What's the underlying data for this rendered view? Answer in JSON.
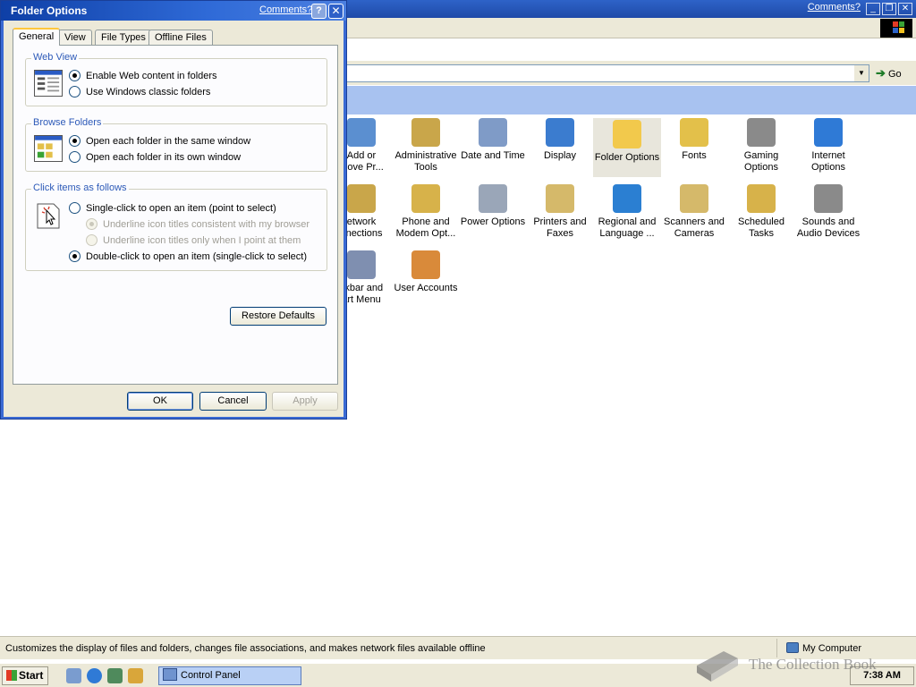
{
  "control_panel": {
    "comments_link": "Comments?",
    "window_buttons": {
      "minimize": "_",
      "maximize": "❐",
      "close": "✕"
    },
    "go_button": "Go",
    "icons": [
      {
        "id": "add-remove-programs",
        "label": "Add or\nRemove Pr...",
        "visible_label": "Add or\nmove Pr...",
        "color": "#5b8fd0"
      },
      {
        "id": "administrative-tools",
        "label": "Administrative\nTools",
        "color": "#c9a64a"
      },
      {
        "id": "date-and-time",
        "label": "Date and Time",
        "color": "#7f9bc7"
      },
      {
        "id": "display",
        "label": "Display",
        "color": "#3b7ccf"
      },
      {
        "id": "folder-options",
        "label": "Folder Options",
        "color": "#f2c94c"
      },
      {
        "id": "fonts",
        "label": "Fonts",
        "color": "#e3c04a"
      },
      {
        "id": "gaming-options",
        "label": "Gaming\nOptions",
        "color": "#8a8a8a"
      },
      {
        "id": "internet-options",
        "label": "Internet\nOptions",
        "color": "#2f7ad6"
      },
      {
        "id": "network-connections",
        "label": "etwork\nnnections",
        "color": "#c9a64a"
      },
      {
        "id": "phone-and-modem",
        "label": "Phone and\nModem Opt...",
        "color": "#d7b24a"
      },
      {
        "id": "power-options",
        "label": "Power Options",
        "color": "#9aa6b8"
      },
      {
        "id": "printers-and-faxes",
        "label": "Printers and\nFaxes",
        "color": "#d5b96a"
      },
      {
        "id": "regional-and-language",
        "label": "Regional and\nLanguage ...",
        "color": "#2b7fd2"
      },
      {
        "id": "scanners-and-cameras",
        "label": "Scanners and\nCameras",
        "color": "#d5b96a"
      },
      {
        "id": "scheduled-tasks",
        "label": "Scheduled\nTasks",
        "color": "#d7b24a"
      },
      {
        "id": "sounds-and-audio",
        "label": "Sounds and\nAudio Devices",
        "color": "#8a8a8a"
      },
      {
        "id": "taskbar-start-menu",
        "label": "skbar and\nart Menu",
        "color": "#7f8fb0"
      },
      {
        "id": "user-accounts",
        "label": "User Accounts",
        "color": "#d98a3a"
      }
    ],
    "status_text": "Customizes the display of files and folders, changes file associations, and makes network files available offline",
    "status_zone": "My Computer"
  },
  "taskbar": {
    "start_label": "Start",
    "task_button": "Control Panel",
    "clock": "7:38 AM",
    "watermark": "The Collection Book"
  },
  "dialog": {
    "title": "Folder Options",
    "comments_link": "Comments?",
    "help": "?",
    "close": "✕",
    "tabs": [
      "General",
      "View",
      "File Types",
      "Offline Files"
    ],
    "active_tab": "General",
    "web_view": {
      "title": "Web View",
      "options": [
        "Enable Web content in folders",
        "Use Windows classic folders"
      ],
      "selected": 0
    },
    "browse_folders": {
      "title": "Browse Folders",
      "options": [
        "Open each folder in the same window",
        "Open each folder in its own window"
      ],
      "selected": 0
    },
    "click_items": {
      "title": "Click items as follows",
      "options": [
        "Single-click to open an item (point to select)",
        "Underline icon titles consistent with my browser",
        "Underline icon titles only when I point at them",
        "Double-click to open an item (single-click to select)"
      ],
      "selected": 3
    },
    "restore_defaults": "Restore Defaults",
    "ok": "OK",
    "cancel": "Cancel",
    "apply": "Apply"
  }
}
